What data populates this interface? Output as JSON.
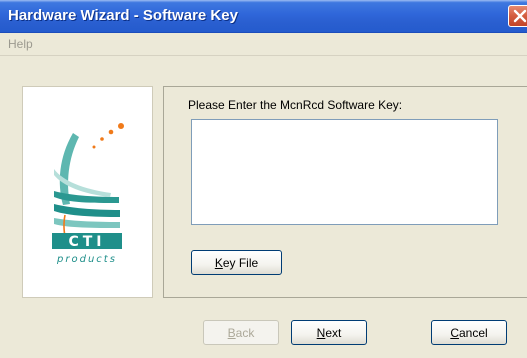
{
  "window": {
    "title": "Hardware Wizard - Software Key"
  },
  "menu": {
    "items": [
      {
        "label": "Help"
      }
    ]
  },
  "logo": {
    "brand_text": "CTI",
    "sub_text": "products"
  },
  "main": {
    "prompt": "Please Enter the McnRcd Software Key:",
    "key_value": "",
    "key_file_button": {
      "accel": "K",
      "rest": "ey File"
    }
  },
  "footer": {
    "back_button": {
      "accel": "B",
      "rest": "ack",
      "enabled": false
    },
    "next_button": {
      "accel": "N",
      "rest": "ext",
      "enabled": true
    },
    "cancel_button": {
      "accel": "C",
      "rest": "ancel",
      "enabled": true
    }
  },
  "colors": {
    "titlebar": "#2a5fd0",
    "dialog_bg": "#ece9d8",
    "logo_teal": "#1f8f8a",
    "logo_orange": "#f07a1a"
  }
}
